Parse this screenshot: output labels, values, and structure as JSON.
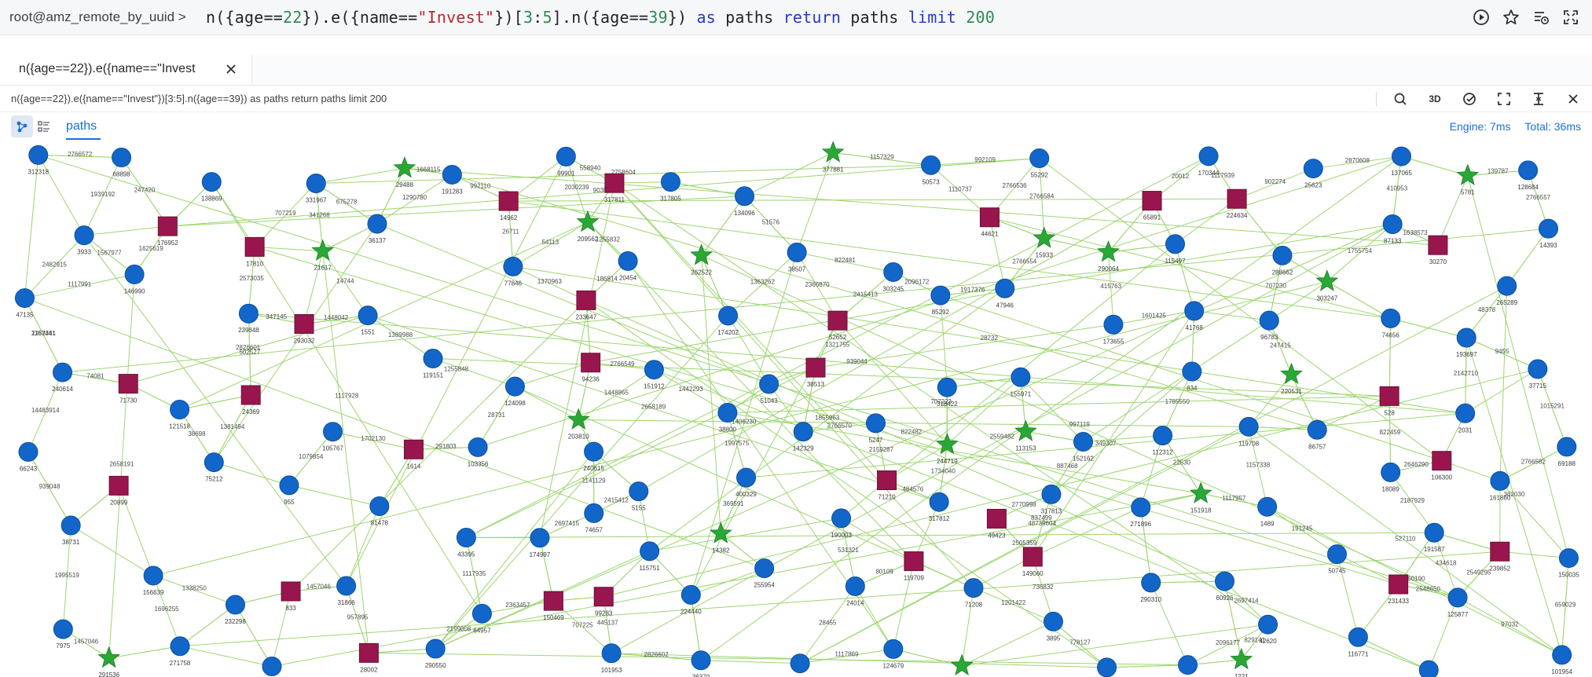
{
  "query_bar": {
    "prompt": "root@amz_remote_by_uuid >",
    "query_tokens": [
      {
        "t": "n(",
        "c": "plain"
      },
      {
        "t": "{",
        "c": "brace"
      },
      {
        "t": "age==",
        "c": "plain"
      },
      {
        "t": "22",
        "c": "num"
      },
      {
        "t": "}",
        "c": "brace"
      },
      {
        "t": ").e(",
        "c": "plain"
      },
      {
        "t": "{",
        "c": "brace"
      },
      {
        "t": "name==",
        "c": "plain"
      },
      {
        "t": "\"Invest\"",
        "c": "str"
      },
      {
        "t": "}",
        "c": "brace"
      },
      {
        "t": ")[",
        "c": "plain"
      },
      {
        "t": "3",
        "c": "num"
      },
      {
        "t": ":",
        "c": "plain"
      },
      {
        "t": "5",
        "c": "num"
      },
      {
        "t": "].n(",
        "c": "plain"
      },
      {
        "t": "{",
        "c": "brace"
      },
      {
        "t": "age==",
        "c": "plain"
      },
      {
        "t": "39",
        "c": "num"
      },
      {
        "t": "}",
        "c": "brace"
      },
      {
        "t": ") ",
        "c": "plain"
      },
      {
        "t": "as",
        "c": "kw"
      },
      {
        "t": " paths ",
        "c": "plain"
      },
      {
        "t": "return",
        "c": "kw"
      },
      {
        "t": " paths ",
        "c": "plain"
      },
      {
        "t": "limit",
        "c": "kw"
      },
      {
        "t": " ",
        "c": "plain"
      },
      {
        "t": "200",
        "c": "num"
      }
    ],
    "icons": [
      "play-icon",
      "star-icon",
      "history-icon",
      "fullscreen-icon"
    ]
  },
  "tab": {
    "label": "n({age==22}).e({name==\"Invest"
  },
  "result_header": {
    "query_text": "n({age==22}).e({name==\"Invest\"})[3:5].n({age==39}) as paths return paths limit 200",
    "tools_3d_label": "3D"
  },
  "view_bar": {
    "paths_label": "paths",
    "engine_time": "Engine: 7ms",
    "total_time": "Total: 36ms"
  },
  "colors": {
    "node_circle": "#1366c9",
    "node_square": "#98164d",
    "node_star": "#2aa836",
    "edge": "#9cd66f",
    "accent": "#1c6ed8"
  },
  "graph": {
    "circle_labels": [
      "31866",
      "101954",
      "55292",
      "77846",
      "24014",
      "146990",
      "112312",
      "87133",
      "101953",
      "38507",
      "18089",
      "7975",
      "66243",
      "96783",
      "3895",
      "103356",
      "400329",
      "331967",
      "47946",
      "50573",
      "42620",
      "128684",
      "170344",
      "75212",
      "151912",
      "5247",
      "105767",
      "125877",
      "1551",
      "69188",
      "64957",
      "20454",
      "239848",
      "68898",
      "193697",
      "173655",
      "317813",
      "74657",
      "303245",
      "317812",
      "240614",
      "99901",
      "191283",
      "1489",
      "2492",
      "47135",
      "25623",
      "156639",
      "71208",
      "290310",
      "51043",
      "155971",
      "86757",
      "312318",
      "232298",
      "36370",
      "12249",
      "317805",
      "36137",
      "150035",
      "116771",
      "81478",
      "121518",
      "74656",
      "271758",
      "255954",
      "37715",
      "115497",
      "119708",
      "142329",
      "138869",
      "161860",
      "38731",
      "124098",
      "2031",
      "134096",
      "288662",
      "174202",
      "955",
      "834",
      "152162",
      "14393",
      "155579",
      "191587",
      "265289",
      "224440",
      "60926",
      "43395",
      "318422",
      "41768",
      "119151",
      "137065",
      "290550",
      "317806",
      "271896",
      "3933",
      "85292",
      "115751",
      "5155",
      "240615",
      "38800",
      "35518",
      "50745",
      "124679",
      "190003",
      "174997"
    ],
    "square_labels": [
      "1614",
      "24369",
      "17810",
      "71210",
      "52652",
      "14962",
      "224634",
      "99283",
      "28002",
      "20899",
      "38513",
      "149060",
      "94236",
      "293032",
      "233647",
      "44621",
      "150469",
      "239852",
      "317811",
      "119709",
      "231433",
      "106300",
      "65891",
      "30270",
      "528",
      "176952",
      "49423",
      "71730",
      "833"
    ],
    "star_labels": [
      "377881",
      "220531",
      "5781",
      "14382",
      "303247",
      "29488",
      "290064",
      "244719",
      "262522",
      "203810",
      "151918",
      "15933",
      "209562",
      "291536",
      "241841",
      "113153",
      "21617",
      "1221"
    ],
    "edge_labels": [
      "1457046",
      "957895",
      "659029",
      "97032",
      "527110",
      "2766536",
      "2766584",
      "992109",
      "903515",
      "26711",
      "1370963",
      "54113",
      "28732",
      "80109",
      "531321",
      "1625619",
      "1567977",
      "2658191",
      "22530",
      "1785550",
      "1638573",
      "410953",
      "1755754",
      "2559482",
      "445137",
      "707225",
      "2826602",
      "51576",
      "2366870",
      "1363262",
      "1406230",
      "2646290",
      "2187929",
      "822459",
      "1457046",
      "1995519",
      "939048",
      "14483914",
      "247415",
      "707230",
      "736832",
      "778127",
      "1201422",
      "291803",
      "28731",
      "369591",
      "1997575",
      "349307",
      "341268",
      "675278",
      "707219",
      "2758604",
      "2766554",
      "1917376",
      "1855963",
      "1110737",
      "1157329",
      "829141",
      "2697414",
      "2096177",
      "707223",
      "139787",
      "2766557",
      "1134281",
      "1117939",
      "20012",
      "1321755",
      "38698",
      "1381494",
      "2766549",
      "1442293",
      "1448965",
      "837499",
      "2159287",
      "2766570",
      "822482",
      "1079854",
      "1702130",
      "400345",
      "2548650",
      "2549295",
      "434618",
      "997119",
      "1448042",
      "1389988",
      "14744",
      "2826601",
      "2766582",
      "1015291",
      "2199008",
      "2363457",
      "1117935",
      "1117928",
      "1255832",
      "186814",
      "347145",
      "2573035",
      "502527",
      "939044",
      "247420",
      "2766572",
      "1939192",
      "48378",
      "2142710",
      "9455",
      "362030",
      "415763",
      "1601425",
      "2770998",
      "887468",
      "48739604",
      "2415412",
      "2697415",
      "1141129",
      "2096172",
      "2415413",
      "822481",
      "484576",
      "1734040",
      "2658189",
      "74081",
      "2363461",
      "558940",
      "2030239",
      "1255848",
      "1668115",
      "992110",
      "1290780",
      "1117957",
      "1157338",
      "191245",
      "160190",
      "1117869",
      "28455",
      "2505359",
      "1157341",
      "2482915",
      "1117991",
      "902274",
      "2870608",
      "1696255",
      "1338250"
    ]
  }
}
